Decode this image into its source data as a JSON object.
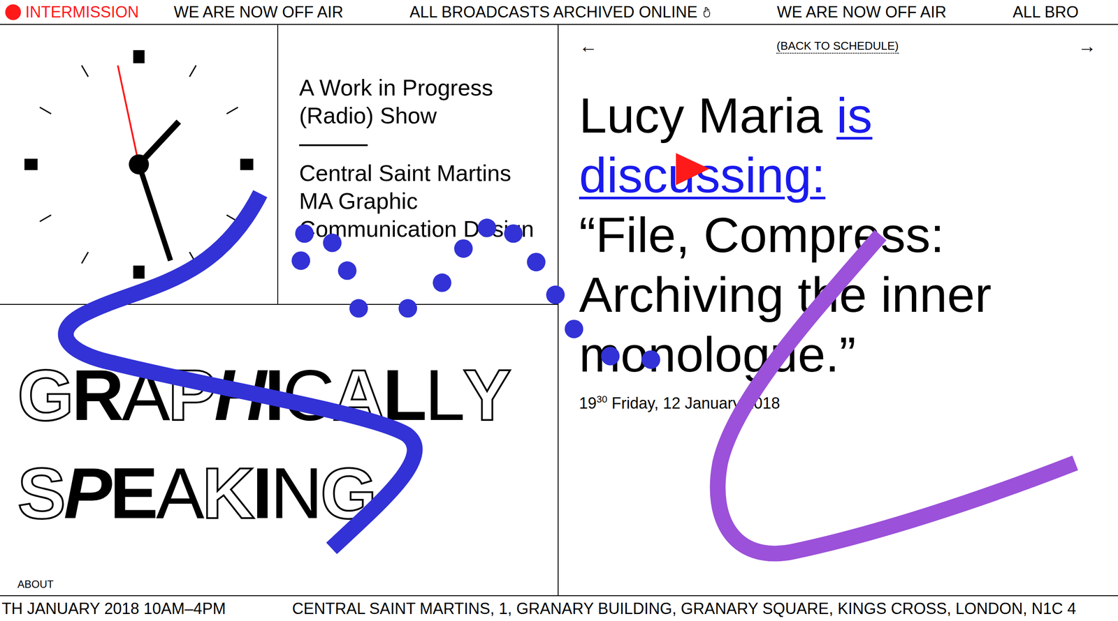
{
  "top_ticker": {
    "status": "INTERMISSION",
    "items": [
      {
        "text": "WE ARE NOW OFF AIR",
        "has_icon": false
      },
      {
        "text": "ALL BROADCASTS ARCHIVED ONLINE",
        "has_icon": true
      },
      {
        "text": "WE ARE NOW OFF AIR",
        "has_icon": false
      },
      {
        "text": "ALL BRO",
        "has_icon": false
      }
    ]
  },
  "clock": {
    "hours": 1,
    "minutes": 26,
    "seconds": 58
  },
  "show_info": {
    "title": "A Work in Progress (Radio) Show",
    "school": "Central Saint Martins MA Graphic Communication Design"
  },
  "logo": {
    "lines": [
      "GRAPHICALLY",
      "SPEAKING"
    ]
  },
  "about": "ABOUT",
  "episode": {
    "nav_prev": "←",
    "back": "(BACK TO SCHEDULE)",
    "nav_next": "→",
    "speaker": "Lucy Maria",
    "verb": "is discussing:",
    "topic": "“File, Compress: Archiving the inner monologue.”",
    "time_hour": "19",
    "time_minute": "30",
    "date": "Friday, 12 January 2018"
  },
  "bottom_ticker": [
    "TH JANUARY 2018 10AM–4PM",
    "CENTRAL SAINT MARTINS, 1, GRANARY BUILDING, GRANARY SQUARE, KINGS CROSS, LONDON, N1C 4"
  ]
}
